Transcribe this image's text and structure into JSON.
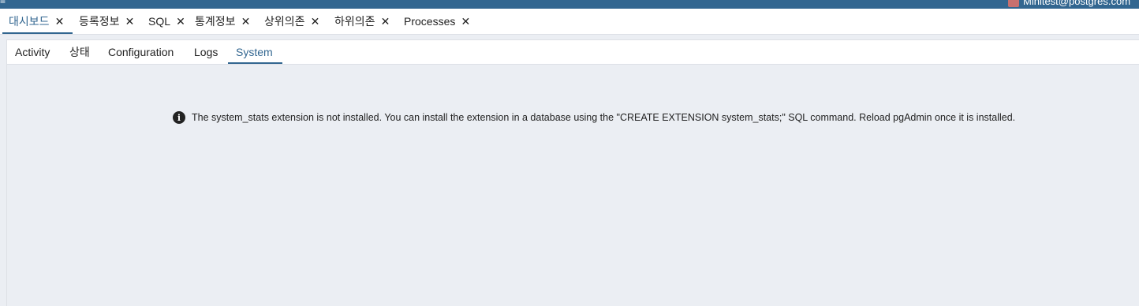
{
  "topbar": {
    "menu_fragment": "≡",
    "user": "Minitest@postgres.com",
    "bg_color": "#326690"
  },
  "main_tabs": [
    {
      "label": "대시보드",
      "active": true,
      "close": "✕"
    },
    {
      "label": "등록정보",
      "active": false,
      "close": "✕"
    },
    {
      "label": "SQL",
      "active": false,
      "close": "✕"
    },
    {
      "label": "통계정보",
      "active": false,
      "close": "✕"
    },
    {
      "label": "상위의존",
      "active": false,
      "close": "✕"
    },
    {
      "label": "하위의존",
      "active": false,
      "close": "✕"
    },
    {
      "label": "Processes",
      "active": false,
      "close": "✕"
    }
  ],
  "sub_tabs": [
    {
      "label": "Activity",
      "active": false
    },
    {
      "label": "상태",
      "active": false
    },
    {
      "label": "Configuration",
      "active": false
    },
    {
      "label": "Logs",
      "active": false
    },
    {
      "label": "System",
      "active": true
    }
  ],
  "message": {
    "icon": "info-icon",
    "text": "The system_stats extension is not installed. You can install the extension in a database using the \"CREATE EXTENSION system_stats;\" SQL command. Reload pgAdmin once it is installed."
  },
  "colors": {
    "accent": "#326690",
    "content_bg": "#ebeef3",
    "text": "#222222"
  }
}
